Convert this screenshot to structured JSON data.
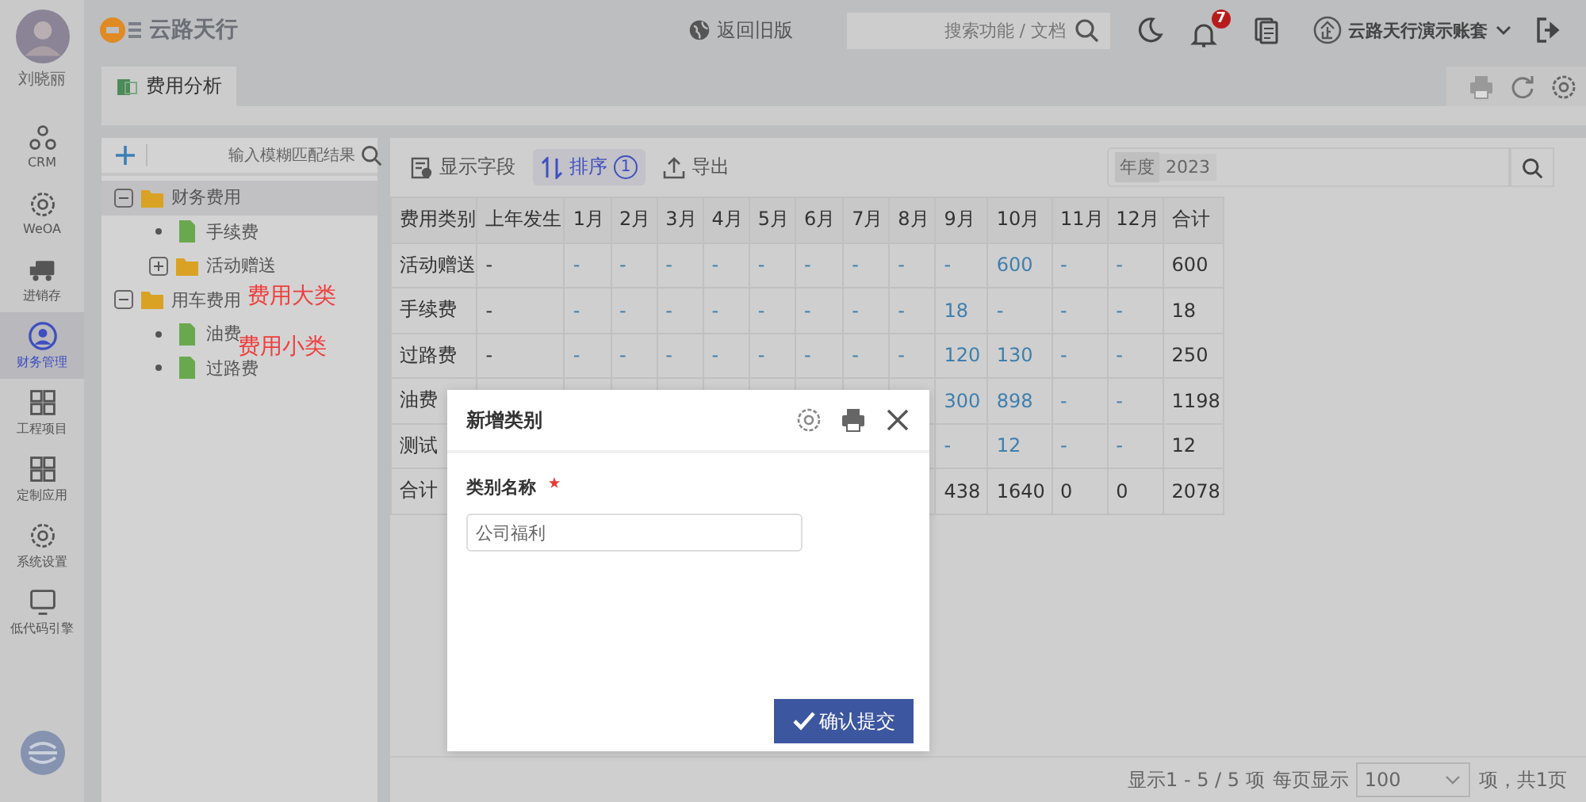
{
  "user": {
    "name": "刘晓丽"
  },
  "logo": {
    "text": "云路天行"
  },
  "topbar": {
    "back_link": "返回旧版",
    "search": {
      "placeholder": "搜索功能 / 文档"
    },
    "notifications": {
      "count": "7"
    },
    "account": "云路天行演示账套"
  },
  "rail": {
    "items": [
      {
        "label": "CRM",
        "kind": "crm",
        "selected": false
      },
      {
        "label": "WeOA",
        "kind": "gear",
        "selected": false
      },
      {
        "label": "进销存",
        "kind": "truck",
        "selected": false
      },
      {
        "label": "财务管理",
        "kind": "person",
        "selected": true
      },
      {
        "label": "工程项目",
        "kind": "grid",
        "selected": false
      },
      {
        "label": "定制应用",
        "kind": "grid",
        "selected": false
      },
      {
        "label": "系统设置",
        "kind": "gear",
        "selected": false
      },
      {
        "label": "低代码引擎",
        "kind": "monitor",
        "selected": false
      }
    ]
  },
  "tabs": [
    {
      "label": "费用分析",
      "selected": true
    }
  ],
  "tree": {
    "search": {
      "placeholder": "输入模糊匹配结果"
    },
    "nodes": [
      {
        "label": "财务费用",
        "kind": "folder",
        "expanded": true,
        "selected": true,
        "children": [
          {
            "label": "手续费",
            "kind": "file",
            "selected": false
          },
          {
            "label": "活动赠送",
            "kind": "folder",
            "expanded": false,
            "selected": false
          }
        ]
      },
      {
        "label": "用车费用",
        "kind": "folder",
        "expanded": true,
        "selected": false,
        "children": [
          {
            "label": "油费",
            "kind": "file",
            "selected": false
          },
          {
            "label": "过路费",
            "kind": "file",
            "selected": false
          }
        ]
      }
    ]
  },
  "annotations": [
    {
      "text": "费用大类"
    },
    {
      "text": "费用小类"
    }
  ],
  "toolbar": {
    "buttons": [
      {
        "label": "显示字段",
        "kind": "fields",
        "active": false
      },
      {
        "label": "排序",
        "kind": "sort",
        "active": true,
        "badge": "1"
      },
      {
        "label": "导出",
        "kind": "export",
        "active": false
      }
    ],
    "year_filter": {
      "label": "年度",
      "value": "2023"
    }
  },
  "table": {
    "columns": [
      {
        "label": "费用类别",
        "kind": "label"
      },
      {
        "label": "上年发生",
        "kind": "prior"
      },
      {
        "label": "1月",
        "kind": "month"
      },
      {
        "label": "2月",
        "kind": "month"
      },
      {
        "label": "3月",
        "kind": "month"
      },
      {
        "label": "4月",
        "kind": "month"
      },
      {
        "label": "5月",
        "kind": "month"
      },
      {
        "label": "6月",
        "kind": "month"
      },
      {
        "label": "7月",
        "kind": "month"
      },
      {
        "label": "8月",
        "kind": "month"
      },
      {
        "label": "9月",
        "kind": "month"
      },
      {
        "label": "10月",
        "kind": "month"
      },
      {
        "label": "11月",
        "kind": "month"
      },
      {
        "label": "12月",
        "kind": "month"
      },
      {
        "label": "合计",
        "kind": "sum"
      }
    ],
    "rows": [
      {
        "kind": "data",
        "cells": [
          "活动赠送",
          "-",
          "-",
          "-",
          "-",
          "-",
          "-",
          "-",
          "-",
          "-",
          "-",
          "600",
          "-",
          "-",
          "600"
        ]
      },
      {
        "kind": "data",
        "cells": [
          "手续费",
          "-",
          "-",
          "-",
          "-",
          "-",
          "-",
          "-",
          "-",
          "-",
          "18",
          "-",
          "-",
          "-",
          "18"
        ]
      },
      {
        "kind": "data",
        "cells": [
          "过路费",
          "-",
          "-",
          "-",
          "-",
          "-",
          "-",
          "-",
          "-",
          "-",
          "120",
          "130",
          "-",
          "-",
          "250"
        ]
      },
      {
        "kind": "data",
        "cells": [
          "油费",
          null,
          null,
          null,
          null,
          null,
          null,
          null,
          null,
          null,
          "300",
          "898",
          "-",
          "-",
          "1198"
        ]
      },
      {
        "kind": "data",
        "cells": [
          "测试",
          null,
          null,
          null,
          null,
          null,
          null,
          null,
          null,
          null,
          "-",
          "12",
          "-",
          "-",
          "12"
        ]
      },
      {
        "kind": "total",
        "cells": [
          "合计",
          null,
          null,
          null,
          null,
          null,
          null,
          null,
          null,
          null,
          "438",
          "1640",
          "0",
          "0",
          "2078"
        ]
      }
    ]
  },
  "pagination": {
    "summary": "显示1 - 5 / 5 项",
    "per_page_label": "每页显示",
    "per_page": "100",
    "pages": "项，共1页"
  },
  "dialog": {
    "title": "新增类别",
    "field": {
      "label": "类别名称",
      "required": true,
      "value": "公司福利"
    },
    "submit": "确认提交"
  }
}
